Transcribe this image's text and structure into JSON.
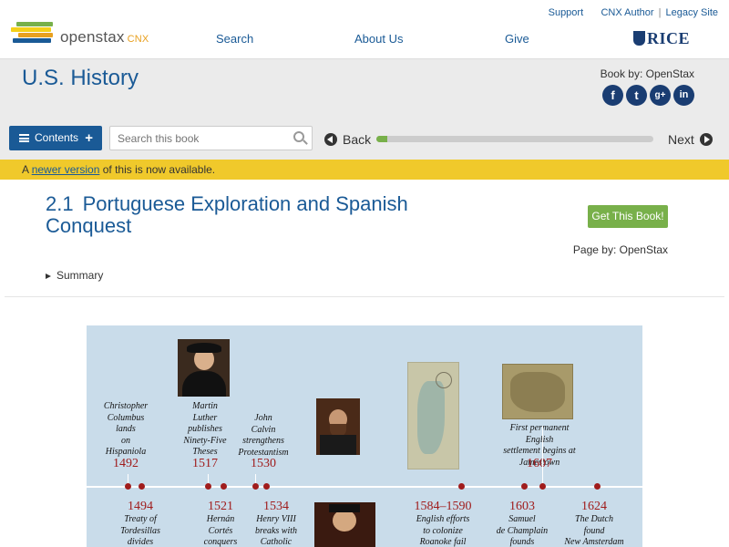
{
  "header": {
    "brand": "openstax",
    "brand_suffix": "CNX",
    "links": [
      "Support",
      "CNX Author",
      "Legacy Site"
    ],
    "nav": [
      "Search",
      "About Us",
      "Give"
    ],
    "partner": "RICE"
  },
  "book": {
    "title": "U.S. History",
    "by": "Book by: OpenStax",
    "social": [
      "f",
      "t",
      "g+",
      "in"
    ]
  },
  "toolbar": {
    "contents_label": "Contents",
    "search_placeholder": "Search this book",
    "back_label": "Back",
    "next_label": "Next",
    "progress": 0.04
  },
  "notice": {
    "prefix": "A",
    "link": "newer version",
    "suffix": "of this is now available."
  },
  "page": {
    "number": "2.1",
    "title": "Portuguese Exploration and Spanish Conquest",
    "get_book": "Get This Book!",
    "page_by": "Page by: OpenStax",
    "summary": "Summary"
  },
  "timeline": {
    "above": [
      {
        "year": "1492",
        "text": [
          "Christopher",
          "Columbus",
          "lands",
          "on",
          "Hispaniola"
        ]
      },
      {
        "year": "1517",
        "text": [
          "Martin",
          "Luther",
          "publishes",
          "Ninety-Five",
          "Theses"
        ]
      },
      {
        "year": "1530",
        "text": [
          "John",
          "Calvin",
          "strengthens",
          "Protestantism"
        ]
      },
      {
        "year": "1607",
        "text": [
          "First permanent English",
          "settlement begins at",
          "Jamestown"
        ]
      }
    ],
    "below": [
      {
        "year": "1494",
        "text": [
          "Treaty of",
          "Tordesillas",
          "divides"
        ]
      },
      {
        "year": "1521",
        "text": [
          "Hernán",
          "Cortés",
          "conquers"
        ]
      },
      {
        "year": "1534",
        "text": [
          "Henry VIII",
          "breaks with",
          "Catholic"
        ]
      },
      {
        "year": "1584–1590",
        "text": [
          "English efforts",
          "to colonize",
          "Roanoke fail"
        ]
      },
      {
        "year": "1603",
        "text": [
          "Samuel",
          "de Champlain",
          "founds"
        ]
      },
      {
        "year": "1624",
        "text": [
          "The Dutch",
          "found",
          "New Amsterdam"
        ]
      }
    ]
  }
}
